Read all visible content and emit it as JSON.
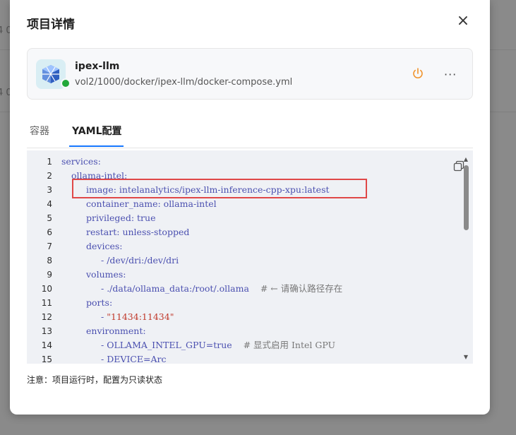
{
  "background": {
    "rows": [
      {
        "text": "4 0"
      },
      {
        "text": "4 0"
      }
    ]
  },
  "modal": {
    "title": "项目详情",
    "close_icon": "×",
    "project": {
      "name": "ipex-llm",
      "path": "vol2/1000/docker/ipex-llm/docker-compose.yml",
      "status_color": "#22a83a",
      "power_color": "#f0932b",
      "more_icon": "···"
    },
    "tabs": [
      {
        "label": "容器"
      },
      {
        "label": "YAML配置"
      }
    ],
    "code_lines": [
      {
        "n": "1",
        "indent": 0,
        "text": "services:"
      },
      {
        "n": "2",
        "indent": 1,
        "text": "ollama-intel:"
      },
      {
        "n": "3",
        "indent": 2,
        "text": "image: intelanalytics/ipex-llm-inference-cpp-xpu:latest"
      },
      {
        "n": "4",
        "indent": 2,
        "text": "container_name: ollama-intel"
      },
      {
        "n": "5",
        "indent": 2,
        "text": "privileged: true"
      },
      {
        "n": "6",
        "indent": 2,
        "text": "restart: unless-stopped"
      },
      {
        "n": "7",
        "indent": 2,
        "text": "devices:"
      },
      {
        "n": "8",
        "indent": 3,
        "text": "- /dev/dri:/dev/dri"
      },
      {
        "n": "9",
        "indent": 2,
        "text": "volumes:"
      },
      {
        "n": "10",
        "indent": 3,
        "text": "- ./data/ollama_data:/root/.ollama",
        "comment": "# ← 请确认路径存在"
      },
      {
        "n": "11",
        "indent": 2,
        "text": "ports:"
      },
      {
        "n": "12",
        "indent": 3,
        "text": "- \"11434:11434\""
      },
      {
        "n": "13",
        "indent": 2,
        "text": "environment:"
      },
      {
        "n": "14",
        "indent": 3,
        "text": "- OLLAMA_INTEL_GPU=true",
        "comment": "# 显式启用 Intel GPU"
      },
      {
        "n": "15",
        "indent": 3,
        "text": "- DEVICE=Arc"
      }
    ],
    "note": "注意：项目运行时，配置为只读状态"
  }
}
